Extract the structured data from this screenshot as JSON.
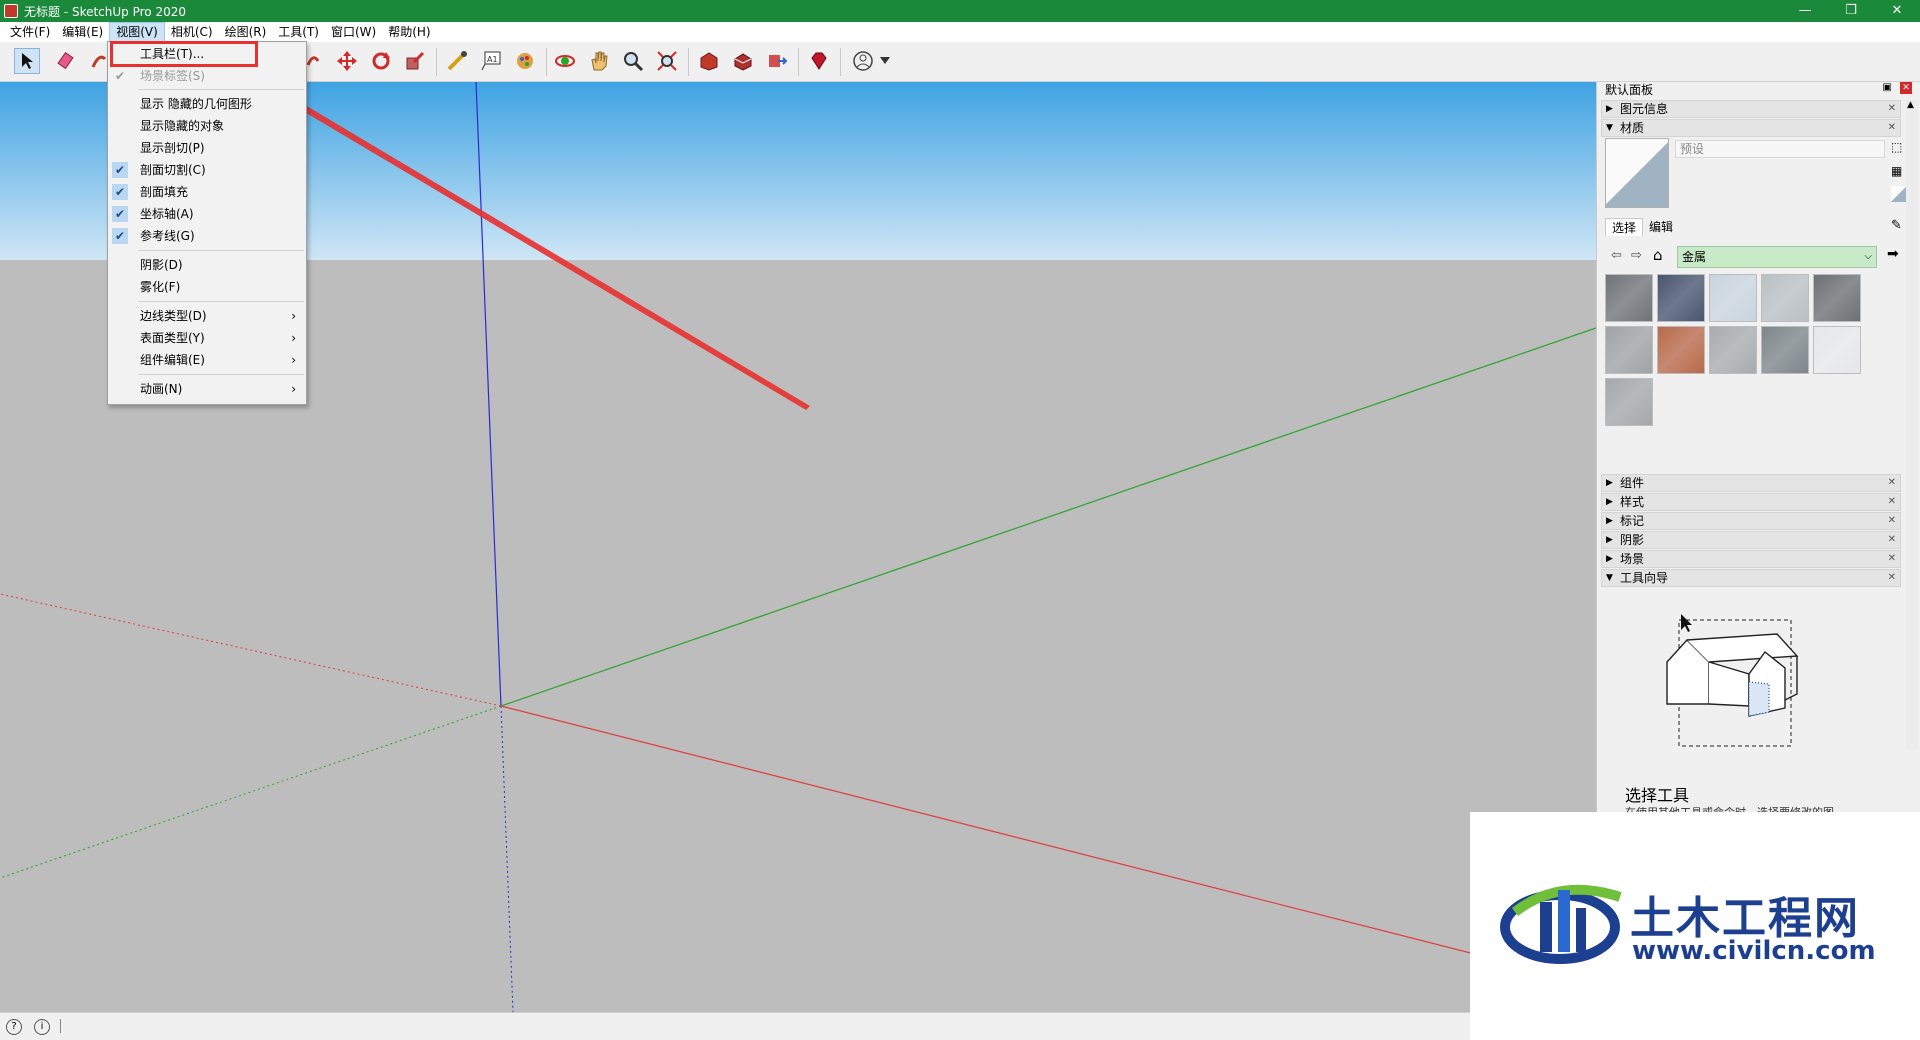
{
  "window": {
    "title": "无标题 - SketchUp Pro 2020",
    "controls": [
      "minimize",
      "restore",
      "close"
    ]
  },
  "menubar": {
    "items": [
      "文件(F)",
      "编辑(E)",
      "视图(V)",
      "相机(C)",
      "绘图(R)",
      "工具(T)",
      "窗口(W)",
      "帮助(H)"
    ]
  },
  "toolbar": {
    "icons": [
      "select-icon",
      "eraser-icon",
      "paint-icon",
      "move-icon",
      "rotate-icon",
      "scale-icon",
      "tape-measure-icon",
      "text-icon",
      "paint-bucket-icon",
      "orbit-icon",
      "pan-icon",
      "zoom-icon",
      "zoom-extents-icon",
      "warehouse-icon",
      "extension-icon",
      "send-icon",
      "ruby-icon",
      "account-icon"
    ]
  },
  "view_menu": {
    "items": [
      {
        "label": "工具栏(T)...",
        "checked": false,
        "disabled": false
      },
      {
        "label": "场景标签(S)",
        "checked": true,
        "disabled": true
      },
      {
        "label": "显示 隐藏的几何图形",
        "checked": false
      },
      {
        "label": "显示隐藏的对象",
        "checked": false
      },
      {
        "label": "显示剖切(P)",
        "checked": false
      },
      {
        "label": "剖面切割(C)",
        "checked": true
      },
      {
        "label": "剖面填充",
        "checked": true
      },
      {
        "label": "坐标轴(A)",
        "checked": true
      },
      {
        "label": "参考线(G)",
        "checked": true
      },
      {
        "label": "阴影(D)",
        "checked": false
      },
      {
        "label": "雾化(F)",
        "checked": false
      },
      {
        "label": "边线类型(D)",
        "submenu": true
      },
      {
        "label": "表面类型(Y)",
        "submenu": true
      },
      {
        "label": "组件编辑(E)",
        "submenu": true
      },
      {
        "label": "动画(N)",
        "submenu": true
      }
    ]
  },
  "panel": {
    "title": "默认面板",
    "sections_top": [
      {
        "label": "图元信息",
        "expanded": false
      },
      {
        "label": "材质",
        "expanded": true
      }
    ],
    "material": {
      "name_placeholder": "预设",
      "tabs": [
        "选择",
        "编辑"
      ],
      "library": "金属",
      "swatch_colors": [
        "#6f7479",
        "#4a5670",
        "#c9d4de",
        "#b9c0c4",
        "#6d7173",
        "#9fa3a6",
        "#b86a4b",
        "#a8acaf",
        "#7e868b",
        "#e6e7e9",
        "#a5a7a9"
      ]
    },
    "sections_bottom": [
      {
        "label": "组件",
        "expanded": false
      },
      {
        "label": "样式",
        "expanded": false
      },
      {
        "label": "标记",
        "expanded": false
      },
      {
        "label": "阴影",
        "expanded": false
      },
      {
        "label": "场景",
        "expanded": false
      },
      {
        "label": "工具向导",
        "expanded": true
      }
    ],
    "guide": {
      "title": "选择工具",
      "text": "在使用其他工具或命令时，选择要修改的图"
    }
  },
  "watermark": {
    "title": "土木工程网",
    "url": "www.civilcn.com"
  },
  "colors": {
    "titlebar": "#1a8a3a",
    "sky_top": "#3fa3e3",
    "ground": "#bdbdbd",
    "axis_red": "#e23b3b",
    "axis_green": "#2aa52a",
    "axis_blue": "#2b2bd0",
    "annotation": "#e8302f"
  }
}
